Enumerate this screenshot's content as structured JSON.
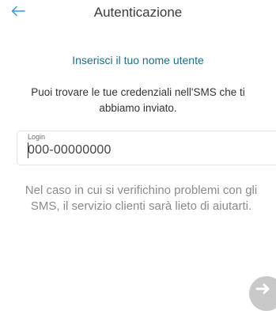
{
  "header": {
    "back_icon": "arrow-left-icon",
    "title": "Autenticazione"
  },
  "main": {
    "subtitle": "Inserisci il tuo nome utente",
    "info": "Puoi trovare le tue credenziali nell'SMS che ti abbiamo inviato.",
    "login_field": {
      "label": "Login",
      "value": "000-00000000"
    },
    "help_text": "Nel caso in cui si verifichino problemi con gli SMS, il servizio clienti sarà lieto di aiutarti.",
    "next_icon": "arrow-right-icon"
  },
  "colors": {
    "accent": "#1a6e8e",
    "back_arrow": "#3a9ad0",
    "fab": "#c9c9c9"
  }
}
